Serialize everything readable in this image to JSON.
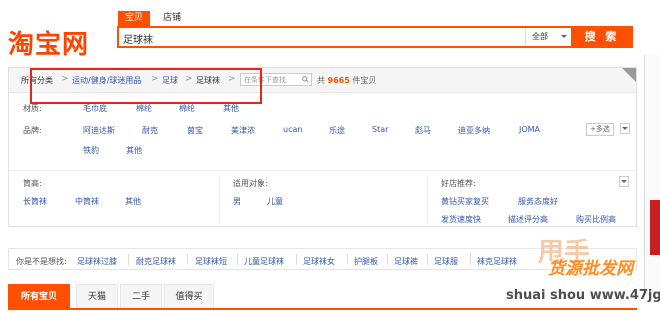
{
  "header": {
    "logo_text": "淘宝网",
    "tabs": [
      "宝贝",
      "店铺"
    ],
    "search_value": "足球袜",
    "category": "全部",
    "search_button": "搜 索"
  },
  "breadcrumb": {
    "items": [
      "所有分类",
      "运动/健身/球迷用品",
      "足球",
      "足球袜"
    ],
    "filter_placeholder": "在条件下查找",
    "count_prefix": "共",
    "count_number": "9665",
    "count_suffix": "件宝贝"
  },
  "attributes": {
    "material_label": "材质:",
    "materials": [
      "毛巾底",
      "棉纶",
      "棉纶",
      "其他"
    ],
    "brand_label": "品牌:",
    "brands_row1": [
      "阿迪达斯",
      "耐克",
      "茵宝",
      "美津浓",
      "ucan",
      "乐途",
      "Star",
      "彪马",
      "迪亚多纳",
      "JOMA"
    ],
    "brands_row2": [
      "铁豹",
      "其他"
    ],
    "multi_select": "+多选",
    "height_label": "筒高:",
    "heights": [
      "长筒袜",
      "中筒袜",
      "其他"
    ],
    "target_label": "适用对象:",
    "targets": [
      "男",
      "儿童"
    ],
    "shop_label": "好店推荐:",
    "shops": [
      "黄钻买家复买",
      "服务态度好",
      "发货速度快",
      "描述评分高",
      "购买比例高"
    ]
  },
  "guess": {
    "label": "你是不是想找:",
    "items": [
      "足球袜过膝",
      "耐克足球袜",
      "足球袜短",
      "儿童足球袜",
      "足球袜女",
      "护腿板",
      "足球裤",
      "足球服",
      "袜克足球袜"
    ]
  },
  "result_tabs": [
    "所有宝贝",
    "天猫",
    "二手",
    "值得买"
  ],
  "watermark": {
    "big": "甩手",
    "line1": "货源批发网",
    "line2": "shuai shou www.47jge.cn"
  },
  "colors": {
    "accent": "#ff5000",
    "link": "#3355aa",
    "annotation": "#e0271b"
  }
}
